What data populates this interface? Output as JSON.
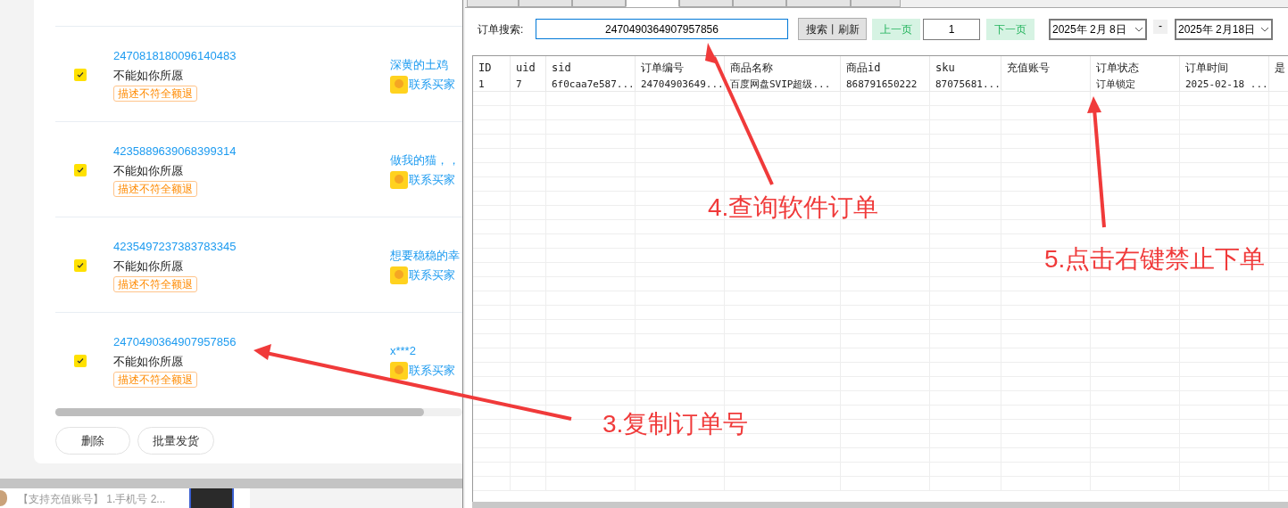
{
  "order_list": {
    "rows": [
      {
        "order_no": "2470818180096140483",
        "reason": "不能如你所愿",
        "tag": "描述不符全额退",
        "buyer": "深黄的土鸡",
        "contact": "联系买家",
        "checked": true
      },
      {
        "order_no": "4235889639068399314",
        "reason": "不能如你所愿",
        "tag": "描述不符全额退",
        "buyer": "做我的猫，，",
        "contact": "联系买家",
        "checked": true
      },
      {
        "order_no": "4235497237383783345",
        "reason": "不能如你所愿",
        "tag": "描述不符全额退",
        "buyer": "想要稳稳的幸",
        "contact": "联系买家",
        "checked": true
      },
      {
        "order_no": "2470490364907957856",
        "reason": "不能如你所愿",
        "tag": "描述不符全额退",
        "buyer": "x***2",
        "contact": "联系买家",
        "checked": true
      }
    ],
    "buttons": [
      "删除",
      "批量发货"
    ]
  },
  "bottom_listing": {
    "text": "【支持充值账号】 1.手机号 2..."
  },
  "app_window": {
    "tabs": [
      {
        "selected": false
      },
      {
        "selected": false
      },
      {
        "selected": false
      },
      {
        "selected": true
      },
      {
        "selected": false
      },
      {
        "selected": false
      },
      {
        "selected": false
      },
      {
        "selected": false
      }
    ],
    "search_label": "订单搜索:",
    "search_value": "2470490364907957856",
    "search_button": "搜索丨刷新",
    "prev_button": "上一页",
    "page": "1",
    "next_button": "下一页",
    "date_from": "2025年 2月 8日",
    "date_separator": "-",
    "date_to": "2025年 2月18日",
    "table": {
      "columns": [
        "ID",
        "uid",
        "sid",
        "订单编号",
        "商品名称",
        "商品id",
        "sku",
        "充值账号",
        "订单状态",
        "订单时间",
        "是"
      ],
      "rows": [
        [
          "1",
          "7",
          "6f0caa7e587...",
          "24704903649...",
          "百度网盘SVIP超级...",
          "868791650222",
          "87075681...",
          "",
          "订单锁定",
          "2025-02-18 ...",
          ""
        ]
      ]
    }
  },
  "annotations": [
    {
      "text": "3.复制订单号"
    },
    {
      "text": "4.查询软件订单"
    },
    {
      "text": "5.点击右键禁止下单"
    }
  ]
}
